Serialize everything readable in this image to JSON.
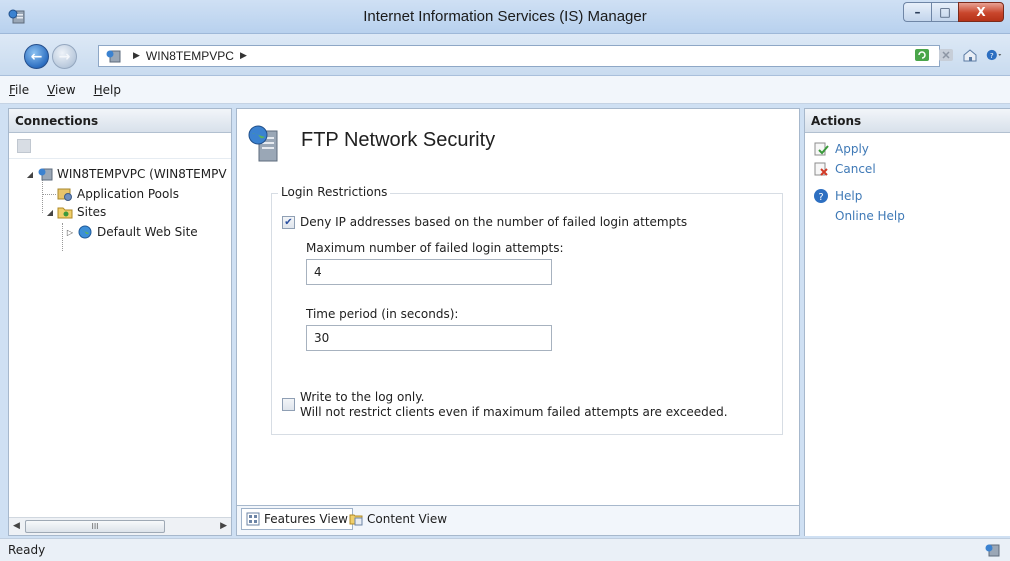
{
  "window": {
    "title": "Internet Information Services (IS) Manager",
    "minimize_label": "–",
    "maximize_label": "□",
    "close_label": "X"
  },
  "address": {
    "path": [
      "WIN8TEMPVPC"
    ],
    "separator": "▶"
  },
  "menu": {
    "file": "File",
    "view": "View",
    "help": "Help"
  },
  "connections": {
    "header": "Connections",
    "tree": [
      {
        "label": "WIN8TEMPVPC (WIN8TEMPV",
        "level": 0,
        "expander": "◢",
        "icon": "server-icon"
      },
      {
        "label": "Application Pools",
        "level": 1,
        "expander": "",
        "icon": "app-pool-icon"
      },
      {
        "label": "Sites",
        "level": 1,
        "expander": "◢",
        "icon": "sites-folder-icon"
      },
      {
        "label": "Default Web Site",
        "level": 2,
        "expander": "▷",
        "icon": "globe-icon"
      }
    ],
    "scroll_thumb_label": "III"
  },
  "main": {
    "title": "FTP Network Security",
    "group_label": "Login Restrictions",
    "deny_ip_label": "Deny IP addresses based on the number of failed login attempts",
    "deny_ip_checked": true,
    "max_attempts_label": "Maximum number of failed login attempts:",
    "max_attempts_value": "4",
    "time_period_label": "Time period (in seconds):",
    "time_period_value": "30",
    "log_only_label": "Write to the log only.",
    "log_only_desc": "Will not restrict clients even if maximum failed attempts are exceeded.",
    "log_only_checked": false
  },
  "views": {
    "features": "Features View",
    "content": "Content View",
    "active": "features"
  },
  "actions": {
    "header": "Actions",
    "apply": "Apply",
    "cancel": "Cancel",
    "help": "Help",
    "online_help": "Online Help"
  },
  "status": {
    "text": "Ready"
  },
  "colors": {
    "link": "#3f79b6",
    "close_button": "#c9462c",
    "frame": "#cfe0f3"
  }
}
